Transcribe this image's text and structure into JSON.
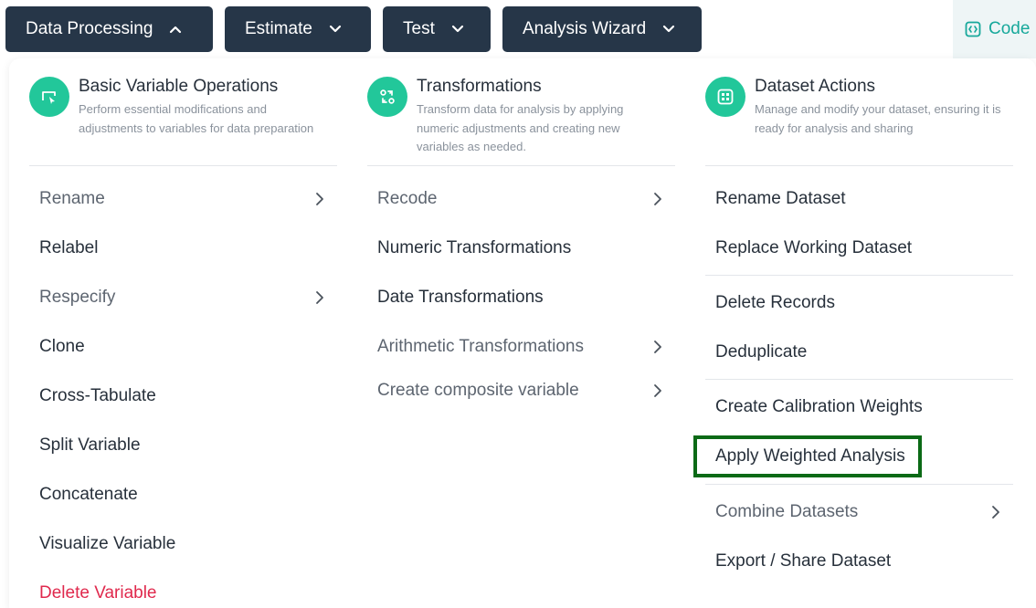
{
  "toolbar": {
    "data_processing": "Data Processing",
    "estimate": "Estimate",
    "test": "Test",
    "analysis_wizard": "Analysis Wizard",
    "code": "Code"
  },
  "columns": {
    "basic": {
      "title": "Basic Variable Operations",
      "description": "Perform essential modifications and adjustments to variables for data preparation",
      "items": [
        "Rename",
        "Relabel",
        "Respecify",
        "Clone",
        "Cross-Tabulate",
        "Split Variable",
        "Concatenate",
        "Visualize Variable",
        "Delete Variable"
      ]
    },
    "transform": {
      "title": "Transformations",
      "description": "Transform data for analysis by applying numeric adjustments and creating new variables as needed.",
      "items": [
        "Recode",
        "Numeric Transformations",
        "Date Transformations",
        "Arithmetic Transformations",
        "Create composite variable"
      ]
    },
    "dataset": {
      "title": "Dataset Actions",
      "description": "Manage and modify your dataset, ensuring it is ready for analysis and sharing",
      "items": [
        "Rename Dataset",
        "Replace Working Dataset",
        "Delete Records",
        "Deduplicate",
        "Create Calibration Weights",
        "Apply Weighted Analysis",
        "Combine Datasets",
        "Export / Share Dataset"
      ]
    }
  },
  "colors": {
    "toolbar_bg": "#263648",
    "accent": "#22c79a",
    "danger": "#e0294d",
    "highlight": "#0b6a16"
  },
  "icons": {
    "basic": "cursor-box-icon",
    "transform": "swap-icon",
    "dataset": "grid-icon"
  }
}
